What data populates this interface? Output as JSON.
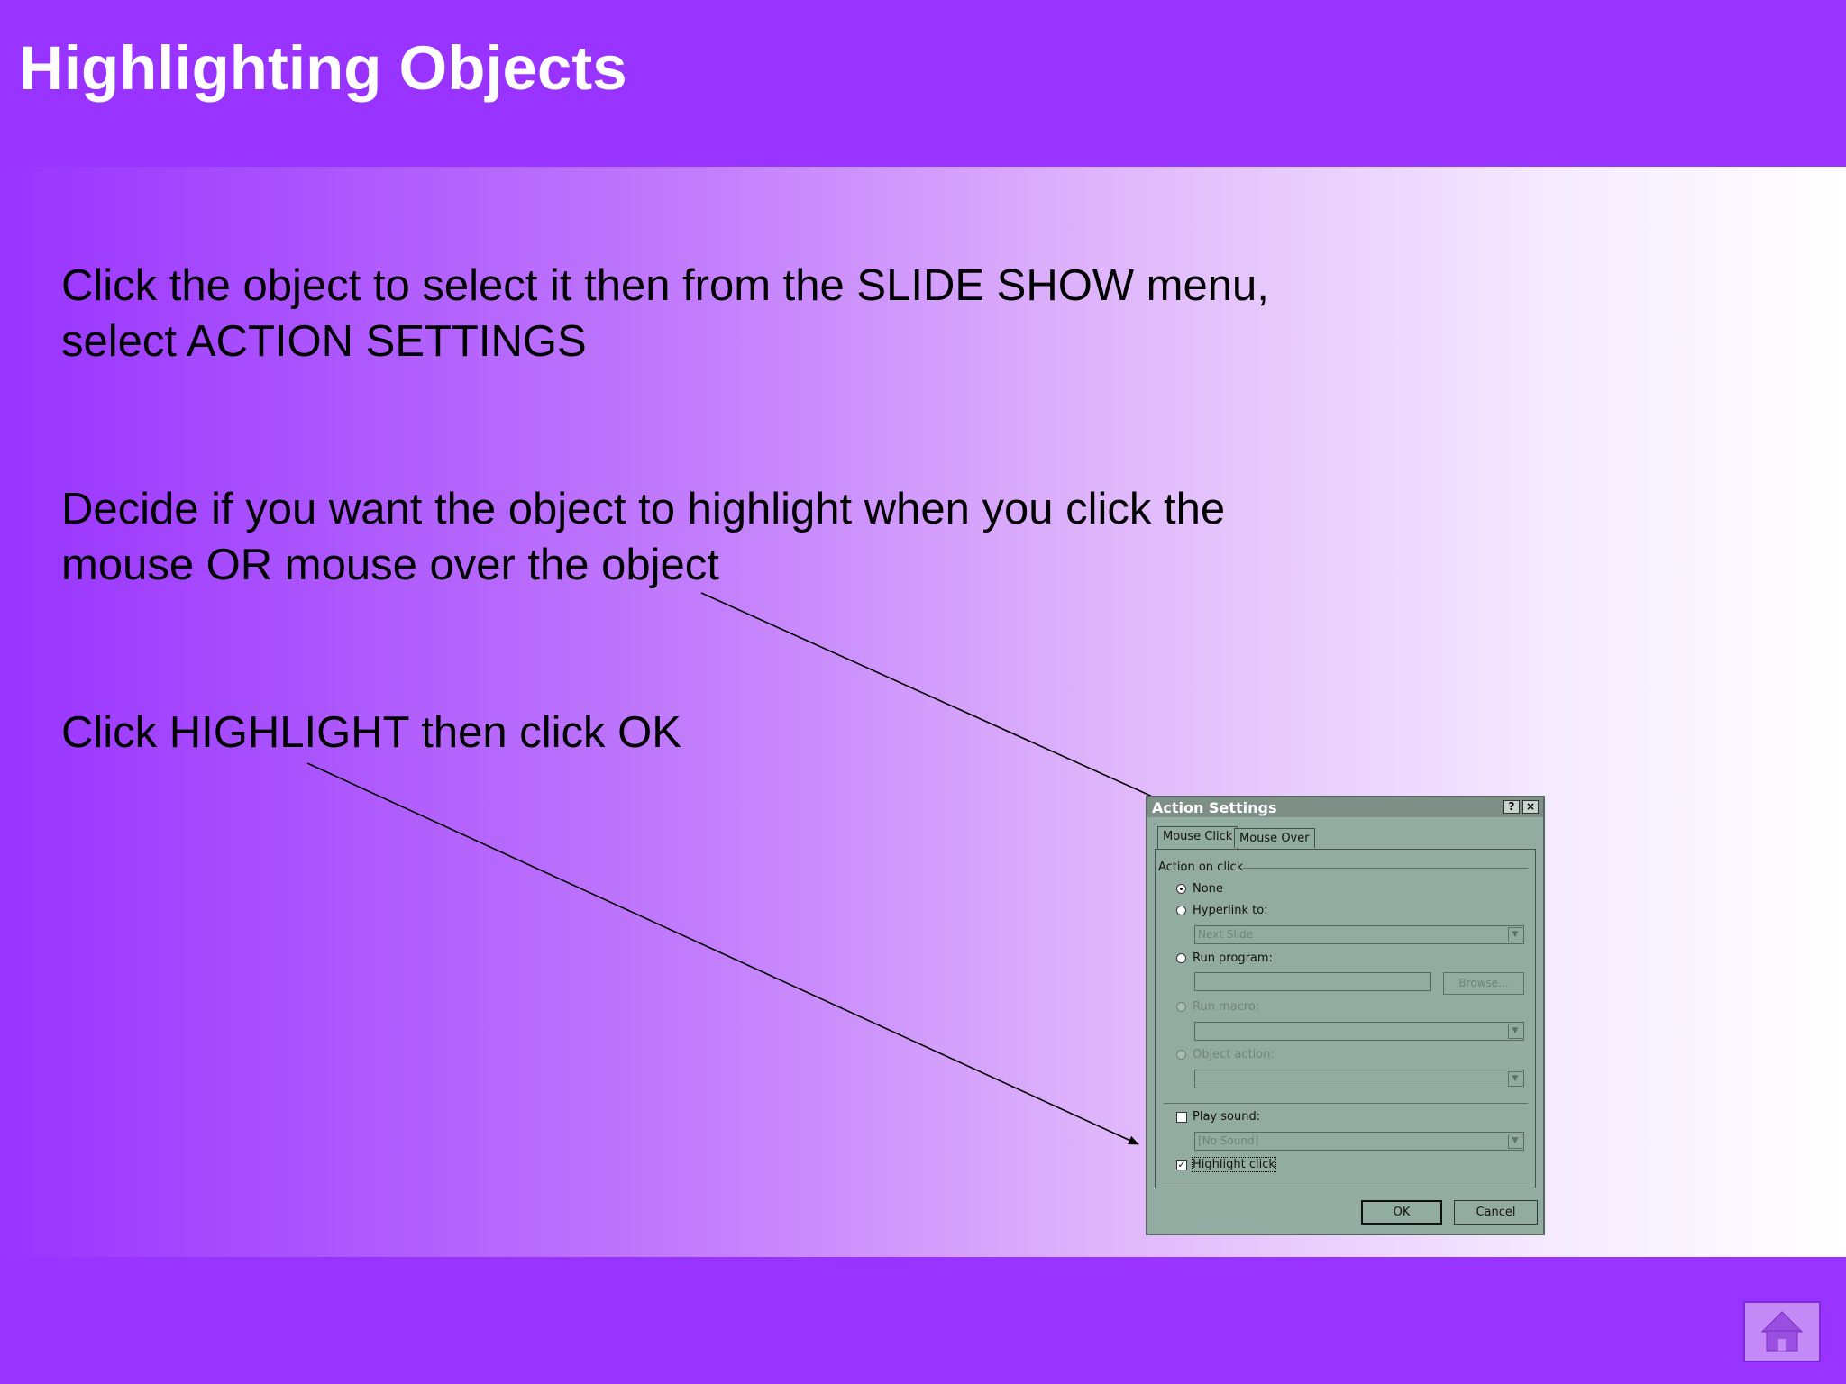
{
  "slide": {
    "title": "Highlighting Objects",
    "paragraphs": [
      [
        "Click the object to select it then from the SLIDE SHOW menu,",
        "select ACTION SETTINGS"
      ],
      [
        "Decide if you want the object to highlight when you click the",
        "mouse OR mouse over the object"
      ],
      [
        "Click HIGHLIGHT then click OK"
      ]
    ]
  },
  "dialog": {
    "title": "Action Settings",
    "help_button": "?",
    "close_button": "×",
    "tabs": [
      "Mouse Click",
      "Mouse Over"
    ],
    "group_label": "Action on click",
    "options": {
      "none": "None",
      "hyperlink": "Hyperlink to:",
      "hyperlink_value": "Next Slide",
      "run_program": "Run program:",
      "browse": "Browse...",
      "run_macro": "Run macro:",
      "object_action": "Object action:"
    },
    "play_sound": "Play sound:",
    "sound_value": "[No Sound]",
    "highlight_click": "Highlight click",
    "ok": "OK",
    "cancel": "Cancel"
  },
  "colors": {
    "accent": "#9933ff",
    "dialog_face": "#93aca1"
  },
  "icons": {
    "home": "home-icon"
  }
}
